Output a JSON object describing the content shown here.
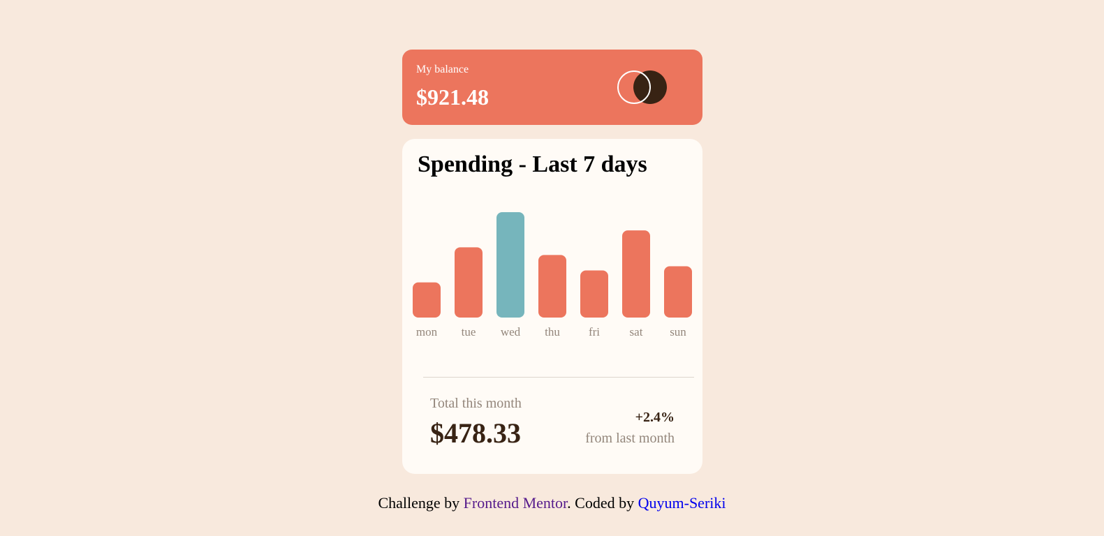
{
  "balance": {
    "label": "My balance",
    "amount": "$921.48"
  },
  "spending": {
    "title": "Spending - Last 7 days",
    "total_label": "Total this month",
    "total_amount": "$478.33",
    "change_percent": "+2.4%",
    "change_note": "from last month"
  },
  "chart_data": {
    "type": "bar",
    "categories": [
      "mon",
      "tue",
      "wed",
      "thu",
      "fri",
      "sat",
      "sun"
    ],
    "values": [
      17.45,
      34.91,
      52.36,
      31.07,
      23.39,
      43.28,
      25.48
    ],
    "highlight_index": 2,
    "color_default": "#ec755d",
    "color_highlight": "#76b5bc"
  },
  "colors": {
    "background": "#f8e9dd",
    "card": "#fffbf6",
    "accent": "#ec755d",
    "dark": "#382314",
    "muted": "#93867b"
  },
  "footer": {
    "prefix": "Challenge by ",
    "mentor_link": "Frontend Mentor",
    "middle": ". Coded by ",
    "author_link": "Quyum-Seriki"
  }
}
